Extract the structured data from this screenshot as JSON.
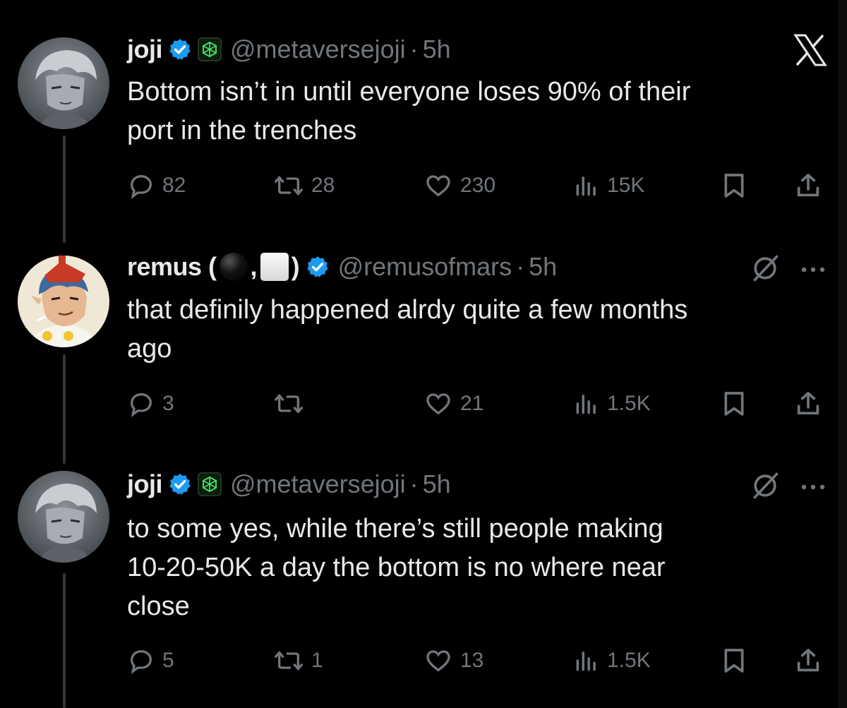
{
  "corner_icon": "x-logo-icon",
  "tweets": [
    {
      "name": "joji",
      "verified": true,
      "affiliate_icon": "green-cube-badge-icon",
      "handle": "@metaversejoji",
      "separator": "·",
      "time": "5h",
      "text_lines": [
        "Bottom isn’t in until everyone loses 90% of their",
        "port in the trenches"
      ],
      "replies": "82",
      "reposts": "28",
      "likes": "230",
      "views": "15K"
    },
    {
      "name": "remus (",
      "name_suffix": ",",
      "name_close": ")",
      "name_emojis": [
        "black-circle-emoji",
        "white-square-emoji"
      ],
      "verified": true,
      "handle": "@remusofmars",
      "separator": "·",
      "time": "5h",
      "text_lines": [
        "that definily happened alrdy quite a few months",
        "ago"
      ],
      "replies": "3",
      "reposts": "",
      "likes": "21",
      "views": "1.5K"
    },
    {
      "name": "joji",
      "verified": true,
      "affiliate_icon": "green-cube-badge-icon",
      "handle": "@metaversejoji",
      "separator": "·",
      "time": "5h",
      "text_lines": [
        "to some yes, while there’s still people making",
        "10-20-50K a day the bottom is no where near",
        "close"
      ],
      "replies": "5",
      "reposts": "1",
      "likes": "13",
      "views": "1.5K"
    }
  ]
}
